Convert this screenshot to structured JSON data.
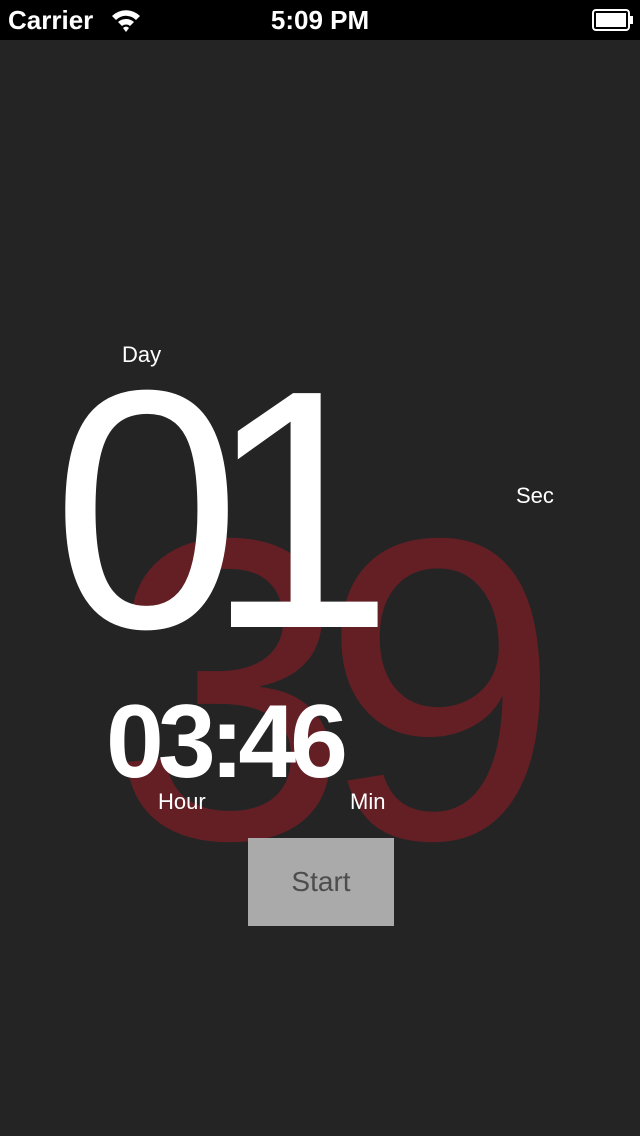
{
  "status_bar": {
    "carrier": "Carrier",
    "time": "5:09 PM",
    "wifi_icon": "wifi-icon",
    "battery_icon": "battery-icon"
  },
  "timer": {
    "day_label": "Day",
    "day_value": "01",
    "sec_label": "Sec",
    "sec_value": "39",
    "hour_value": "03",
    "separator": ":",
    "min_value": "46",
    "hour_label": "Hour",
    "min_label": "Min"
  },
  "controls": {
    "start_label": "Start"
  },
  "colors": {
    "background": "#242424",
    "status_bar": "#000000",
    "seconds_accent": "#8c1c26",
    "button": "#aaaaaa"
  }
}
